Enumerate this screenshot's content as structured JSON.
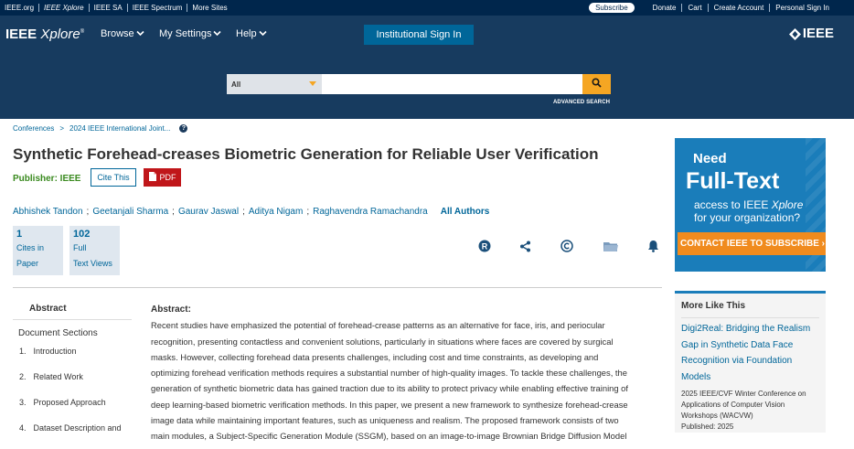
{
  "topbar": {
    "links": [
      "IEEE.org",
      "IEEE Xplore",
      "IEEE SA",
      "IEEE Spectrum",
      "More Sites"
    ],
    "subscribe": "Subscribe",
    "right_links": [
      "Donate",
      "Cart",
      "Create Account",
      "Personal Sign In"
    ]
  },
  "header": {
    "logo_main": "IEEE",
    "logo_italic": "Xplore",
    "logo_reg": "®",
    "nav": [
      "Browse",
      "My Settings",
      "Help"
    ],
    "signin": "Institutional Sign In",
    "ieee_logo": "IEEE",
    "search_scope": "All",
    "search_placeholder": "",
    "advanced_search": "ADVANCED SEARCH"
  },
  "breadcrumb": [
    "Conferences",
    "2024 IEEE International Joint..."
  ],
  "article": {
    "title": "Synthetic Forehead-creases Biometric Generation for Reliable User Verification",
    "publisher_label": "Publisher: IEEE",
    "cite_label": "Cite This",
    "pdf_label": "PDF",
    "authors": [
      "Abhishek Tandon",
      "Geetanjali Sharma",
      "Gaurav Jaswal",
      "Aditya Nigam",
      "Raghavendra Ramachandra"
    ],
    "all_authors": "All Authors",
    "metrics": [
      {
        "num": "1",
        "l1": "Cites in",
        "l2": "Paper"
      },
      {
        "num": "102",
        "l1": "Full",
        "l2": "Text Views"
      }
    ]
  },
  "leftnav": {
    "abstract": "Abstract",
    "doc_sections": "Document Sections",
    "items": [
      {
        "n": "1.",
        "label": "Introduction"
      },
      {
        "n": "2.",
        "label": "Related Work"
      },
      {
        "n": "3.",
        "label": "Proposed Approach"
      },
      {
        "n": "4.",
        "label": "Dataset Description and"
      }
    ]
  },
  "abstract": {
    "heading": "Abstract:",
    "lines": [
      "Recent studies have emphasized the potential of forehead-crease patterns as an alternative for face, iris, and periocular",
      "recognition, presenting contactless and convenient solutions, particularly in situations where faces are covered by surgical",
      "masks. However, collecting forehead data presents challenges, including cost and time constraints, as developing and",
      "optimizing forehead verification methods requires a substantial number of high-quality images. To tackle these challenges, the",
      "generation of synthetic biometric data has gained traction due to its ability to protect privacy while enabling effective training of",
      "deep learning-based biometric verification methods. In this paper, we present a new framework to synthesize forehead-crease",
      "image data while maintaining important features, such as uniqueness and realism. The proposed framework consists of two",
      "main modules, a Subject-Specific Generation Module (SSGM), based on an image-to-image Brownian Bridge Diffusion Model"
    ]
  },
  "ad": {
    "need": "Need",
    "full_text": "Full-Text",
    "access_1": "access to IEEE ",
    "access_xplore": "Xplore",
    "access_2": "for your organization?",
    "cta": "CONTACT IEEE TO SUBSCRIBE ›"
  },
  "more_like_this": {
    "heading": "More Like This",
    "title": "Digi2Real: Bridging the Realism Gap in Synthetic Data Face Recognition via Foundation Models",
    "conference": "2025 IEEE/CVF Winter Conference on Applications of Computer Vision Workshops (WACVW)",
    "published": "Published: 2025"
  },
  "colors": {
    "topbar": "#00264c",
    "header": "#173b5f",
    "link": "#006699",
    "search_button": "#f5a623",
    "pdf": "#c0161a",
    "ad": "#1a7dba",
    "cta": "#f08b1e"
  }
}
